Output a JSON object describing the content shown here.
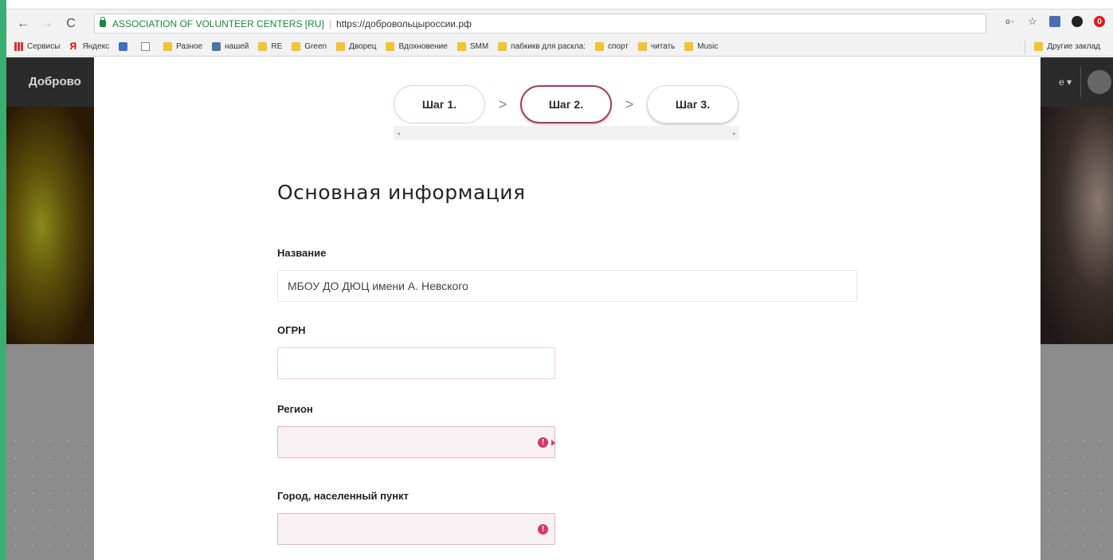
{
  "browser": {
    "site_name": "ASSOCIATION OF VOLUNTEER CENTERS [RU]",
    "url": "https://добровольцыроссии.рф",
    "nav": {
      "back": "←",
      "forward": "→",
      "reload": "C"
    },
    "extension_icons": [
      "key-icon",
      "star-icon",
      "ext-blue-icon",
      "ext-dark-icon",
      "opera-icon"
    ],
    "bookmarks": [
      {
        "label": "Сервисы",
        "icon": "apps-icon"
      },
      {
        "label": "Яндекс",
        "icon": "yandex-icon"
      },
      {
        "label": "",
        "icon": "blue-app-icon"
      },
      {
        "label": "",
        "icon": "doc-icon"
      },
      {
        "label": "Разное",
        "icon": "folder-icon"
      },
      {
        "label": "нашей",
        "icon": "vk-icon"
      },
      {
        "label": "RE",
        "icon": "folder-icon"
      },
      {
        "label": "Green",
        "icon": "folder-icon"
      },
      {
        "label": "Дворец",
        "icon": "folder-icon"
      },
      {
        "label": "Вдохновение",
        "icon": "folder-icon"
      },
      {
        "label": "SMM",
        "icon": "folder-icon"
      },
      {
        "label": "пабкикв для раcкла:",
        "icon": "folder-icon"
      },
      {
        "label": "спорт",
        "icon": "folder-icon"
      },
      {
        "label": "читать",
        "icon": "folder-icon"
      },
      {
        "label": "Music",
        "icon": "folder-icon"
      }
    ],
    "other_bookmarks": "Другие заклад"
  },
  "site": {
    "logo": "Доброво",
    "menu_caret": "е ▾"
  },
  "modal": {
    "steps": [
      {
        "label": "Шаг 1.",
        "state": "done"
      },
      {
        "label": "Шаг 2.",
        "state": "active"
      },
      {
        "label": "Шаг 3.",
        "state": "next"
      }
    ],
    "chevron": ">",
    "scroll_left": "◂",
    "scroll_right": "▸",
    "section_title": "Основная информация",
    "fields": {
      "name": {
        "label": "Название",
        "value": "МБОУ ДО ДЮЦ имени А. Невского"
      },
      "ogrn": {
        "label": "ОГРН",
        "value": ""
      },
      "region": {
        "label": "Регион",
        "value": "",
        "error_icon": "!"
      },
      "city": {
        "label": "Город, населенный пункт",
        "value": "",
        "error_icon": "!"
      }
    }
  },
  "colors": {
    "accent": "#a53a5b",
    "error": "#d9356f",
    "secure_green": "#138a3c"
  }
}
